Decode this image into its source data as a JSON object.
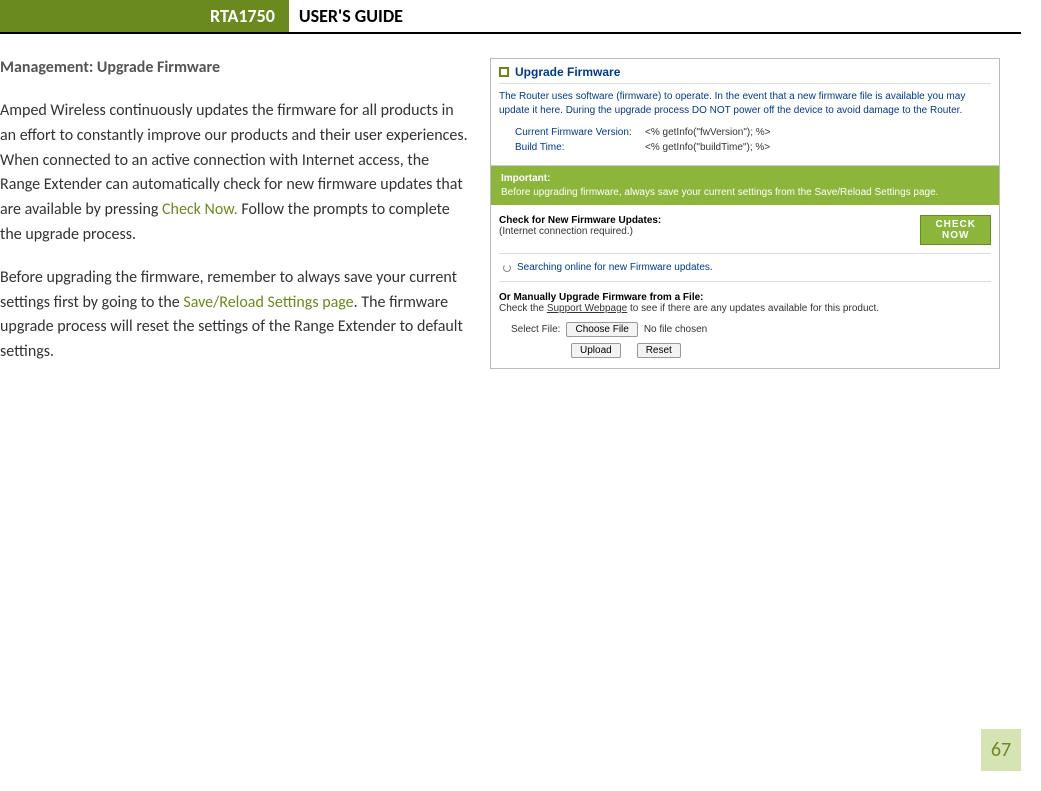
{
  "header": {
    "badge": "RTA1750",
    "title": "USER'S GUIDE"
  },
  "section_title": "Management: Upgrade Firmware",
  "para1": {
    "pre": "Amped Wireless continuously updates the firmware for all products in an effort to constantly improve our products and their user experiences. When connected to an active connection with Internet access, the Range Extender can automatically check for new firmware updates that are available by pressing ",
    "link": "Check Now.",
    "post": " Follow the prompts to complete the upgrade process."
  },
  "para2": {
    "pre": "Before upgrading the firmware, remember to always save your current settings first by going to the ",
    "link": "Save/Reload Settings page",
    "post": ". The firmware upgrade process will reset the settings of the Range Extender to default settings."
  },
  "panel": {
    "title": "Upgrade Firmware",
    "intro": "The Router uses software (firmware) to operate. In the event that a new firmware file is available you may update it here. During the upgrade process DO NOT power off the device to avoid damage to the Router.",
    "fw_label": "Current Firmware Version:",
    "fw_value": "<% getInfo(\"fwVersion\"); %>",
    "bt_label": "Build Time:",
    "bt_value": "<% getInfo(\"buildTime\"); %>",
    "important_head": "Important:",
    "important_body": "Before upgrading firmware, always save your current settings from the Save/Reload Settings page.",
    "check_head": "Check for New Firmware Updates:",
    "check_sub": "(Internet connection required.)",
    "check_btn_l1": "CHECK",
    "check_btn_l2": "NOW",
    "searching": "Searching online for new Firmware updates.",
    "manual_head": "Or Manually Upgrade Firmware from a File:",
    "manual_sub_pre": "Check the ",
    "manual_sub_link": "Support Webpage",
    "manual_sub_post": " to see if there are any updates available for this product.",
    "select_file_label": "Select File:",
    "choose_file_btn": "Choose File",
    "no_file": "No file chosen",
    "upload_btn": "Upload",
    "reset_btn": "Reset"
  },
  "page_number": "67"
}
